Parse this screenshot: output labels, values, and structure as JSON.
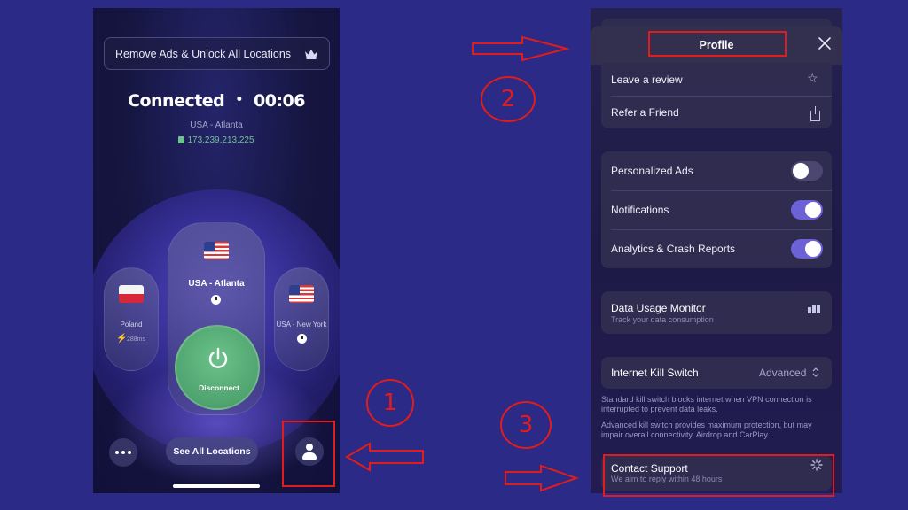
{
  "left_screen": {
    "promo_banner": "Remove Ads & Unlock All Locations",
    "status_label": "Connected",
    "separator": "•",
    "timer": "00:06",
    "location": "USA - Atlanta",
    "ip_address": "173.239.213.225",
    "current_server": "USA - Atlanta",
    "left_server": {
      "name": "Poland",
      "latency": "288ms"
    },
    "right_server": {
      "name": "USA - New York"
    },
    "disconnect_label": "Disconnect",
    "see_all_label": "See All Locations"
  },
  "right_screen": {
    "title": "Profile",
    "review_label": "Leave a review",
    "refer_label": "Refer a Friend",
    "toggles": [
      {
        "label": "Personalized Ads",
        "on": false
      },
      {
        "label": "Notifications",
        "on": true
      },
      {
        "label": "Analytics & Crash Reports",
        "on": true
      }
    ],
    "data_usage": {
      "title": "Data Usage Monitor",
      "subtitle": "Track your data consumption"
    },
    "kill_switch": {
      "label": "Internet Kill Switch",
      "value": "Advanced"
    },
    "note_standard": "Standard kill switch blocks internet when VPN connection is interrupted to prevent data leaks.",
    "note_advanced": "Advanced kill switch provides maximum protection, but may impair overall connectivity, Airdrop and CarPlay.",
    "support": {
      "title": "Contact Support",
      "subtitle": "We aim to reply within 48 hours"
    }
  },
  "annotations": {
    "step1": "1",
    "step2": "2",
    "step3": "3"
  },
  "colors": {
    "background": "#2b2a86",
    "annotation": "#e11c1c",
    "connected_green": "#6fc28f",
    "toggle_on": "#6c61d6"
  }
}
